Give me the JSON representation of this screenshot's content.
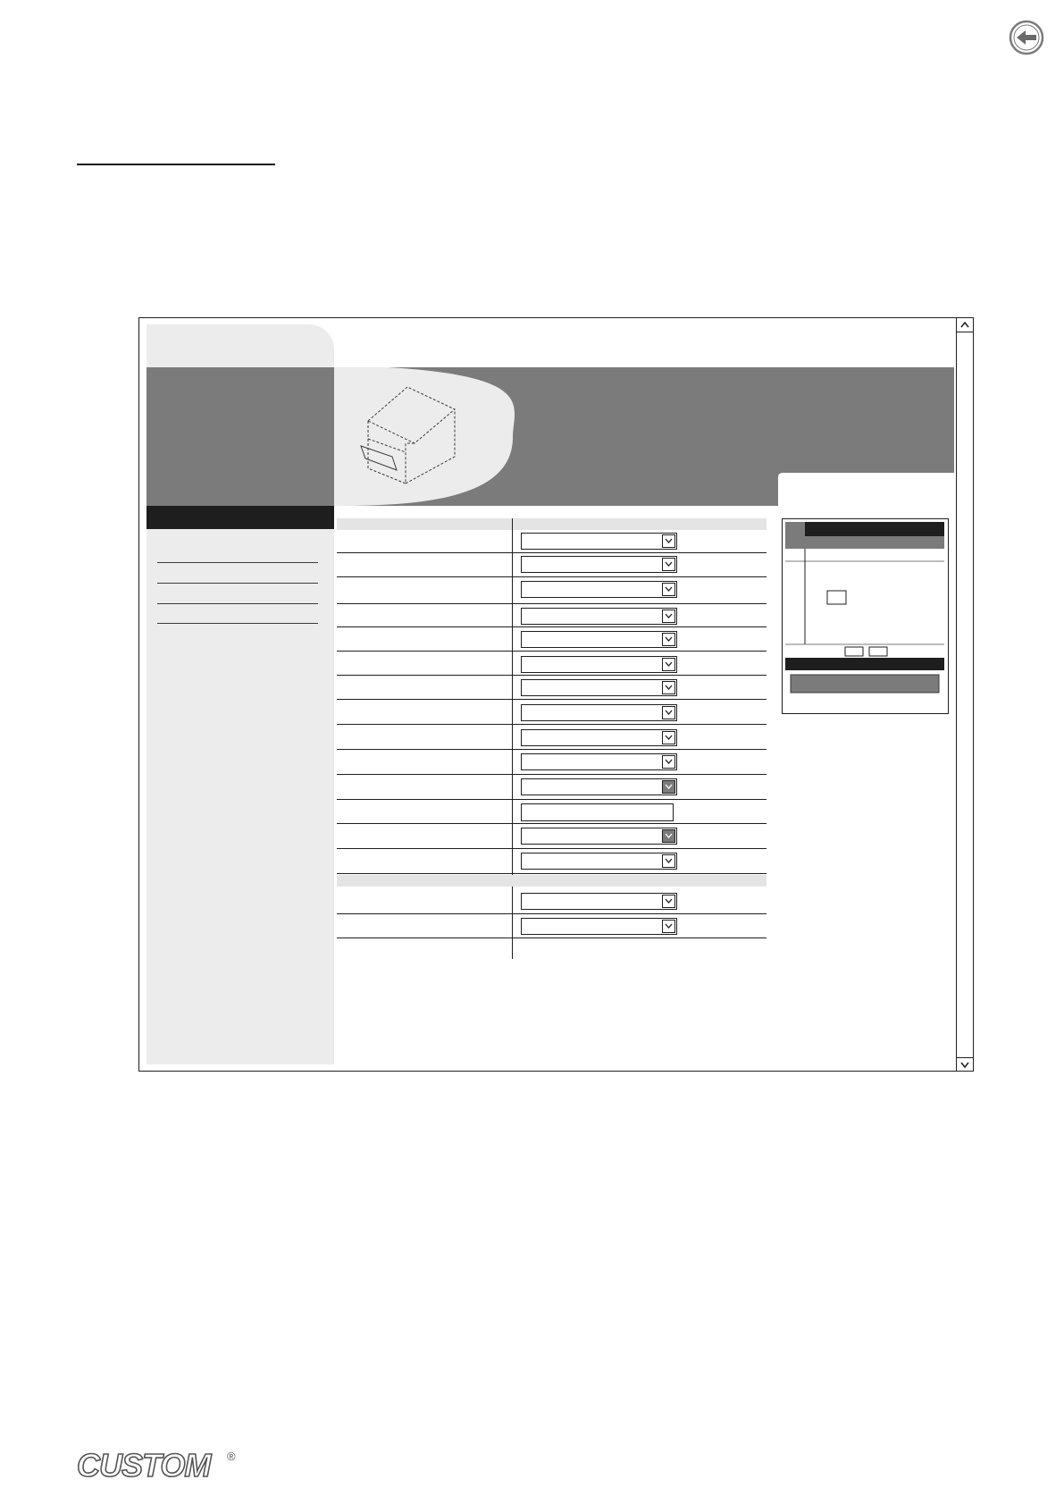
{
  "icons": {
    "back": "arrow-left-circle-icon",
    "printer": "printer-illustration-icon",
    "scroll_up": "chevron-up-icon",
    "scroll_down": "chevron-down-icon",
    "dropdown": "chevron-down-icon"
  },
  "colors": {
    "dark": "#1e1e1e",
    "mid_grey": "#7b7b7b",
    "light_grey": "#ececec",
    "section_grey": "#e4e4e4"
  },
  "logo": {
    "text": "CUSTOM",
    "mark": "®"
  },
  "form": {
    "section_1": {
      "rows": [
        {
          "control": "select"
        },
        {
          "control": "select"
        },
        {
          "control": "select"
        },
        {
          "control": "select"
        },
        {
          "control": "select"
        },
        {
          "control": "select"
        },
        {
          "control": "select"
        },
        {
          "control": "select"
        },
        {
          "control": "select"
        },
        {
          "control": "select"
        },
        {
          "control": "select",
          "highlighted": true
        },
        {
          "control": "text"
        },
        {
          "control": "select",
          "highlighted": true
        },
        {
          "control": "select"
        }
      ]
    },
    "section_2": {
      "rows": [
        {
          "control": "select"
        },
        {
          "control": "select"
        }
      ]
    }
  },
  "sidebar": {
    "menu_item_count": 4
  }
}
